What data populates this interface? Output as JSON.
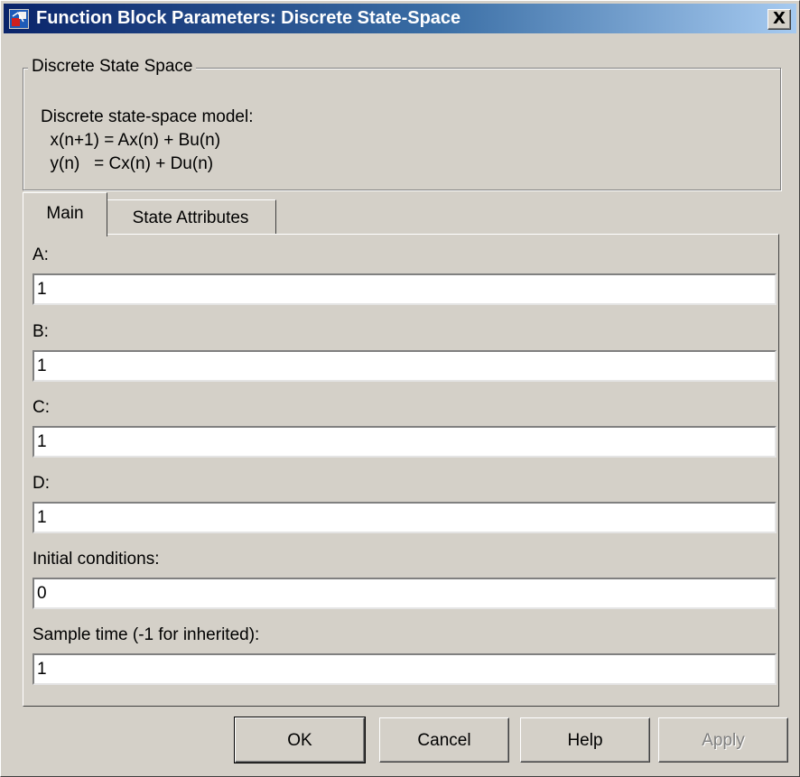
{
  "window": {
    "title": "Function Block Parameters: Discrete State-Space",
    "close_glyph": "X"
  },
  "group": {
    "legend": "Discrete State Space",
    "description": [
      "Discrete state-space model:",
      "  x(n+1) = Ax(n) + Bu(n)",
      "  y(n)   = Cx(n) + Du(n)"
    ]
  },
  "tabs": [
    {
      "label": "Main",
      "selected": true
    },
    {
      "label": "State Attributes",
      "selected": false
    }
  ],
  "fields": [
    {
      "label": "A:",
      "value": "1"
    },
    {
      "label": "B:",
      "value": "1"
    },
    {
      "label": "C:",
      "value": "1"
    },
    {
      "label": "D:",
      "value": "1"
    },
    {
      "label": "Initial conditions:",
      "value": "0"
    },
    {
      "label": "Sample time (-1 for inherited):",
      "value": "1"
    }
  ],
  "buttons": {
    "ok": "OK",
    "cancel": "Cancel",
    "help": "Help",
    "apply": "Apply"
  },
  "colors": {
    "titlebar_start": "#0a246a",
    "titlebar_end": "#a6caf0",
    "face": "#d4d0c8"
  }
}
